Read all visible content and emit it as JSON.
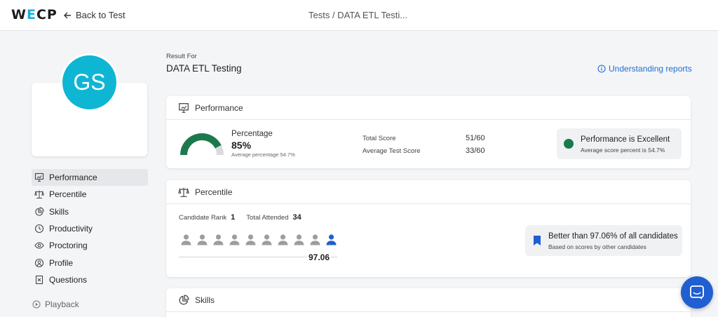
{
  "app": {
    "logo_prefix": "W",
    "logo_dot": "E",
    "logo_suffix": "CP",
    "back_label": "Back to Test",
    "breadcrumb": "Tests / DATA ETL Testi..."
  },
  "candidate": {
    "initials": "GS"
  },
  "nav": [
    {
      "label": "Performance",
      "icon": "presentation-icon",
      "active": true
    },
    {
      "label": "Percentile",
      "icon": "scale-icon"
    },
    {
      "label": "Skills",
      "icon": "pie-chart-icon"
    },
    {
      "label": "Productivity",
      "icon": "clock-icon"
    },
    {
      "label": "Proctoring",
      "icon": "eye-icon"
    },
    {
      "label": "Profile",
      "icon": "user-icon"
    },
    {
      "label": "Questions",
      "icon": "document-icon"
    }
  ],
  "playback_label": "Playback",
  "header": {
    "result_for": "Result For",
    "test_name": "DATA ETL Testing",
    "understanding_link": "Understanding reports"
  },
  "performance": {
    "title": "Performance",
    "percentage_label": "Percentage",
    "percentage_value": "85%",
    "percentage_fraction": 0.85,
    "average_text": "Average percentage 54.7%",
    "total_score_label": "Total Score",
    "total_score_value": "51/60",
    "avg_test_score_label": "Average Test Score",
    "avg_test_score_value": "33/60",
    "status_title": "Performance is Excellent",
    "status_sub": "Average score percent is 54.7%",
    "status_color": "#1b7a4c",
    "gauge_color": "#1b7a4c"
  },
  "percentile": {
    "title": "Percentile",
    "rank_label": "Candidate Rank",
    "rank_value": "1",
    "attended_label": "Total Attended",
    "attended_value": "34",
    "people_total": 10,
    "people_highlighted_index": 9,
    "percentile_value": "97.06",
    "better_title": "Better than 97.06% of all candidates",
    "better_sub": "Based on scores by other candidates",
    "accent_color": "#1f5fd1"
  },
  "skills": {
    "title": "Skills"
  },
  "colors": {
    "avatar": "#0fb6d3",
    "link": "#1f6fd1"
  }
}
